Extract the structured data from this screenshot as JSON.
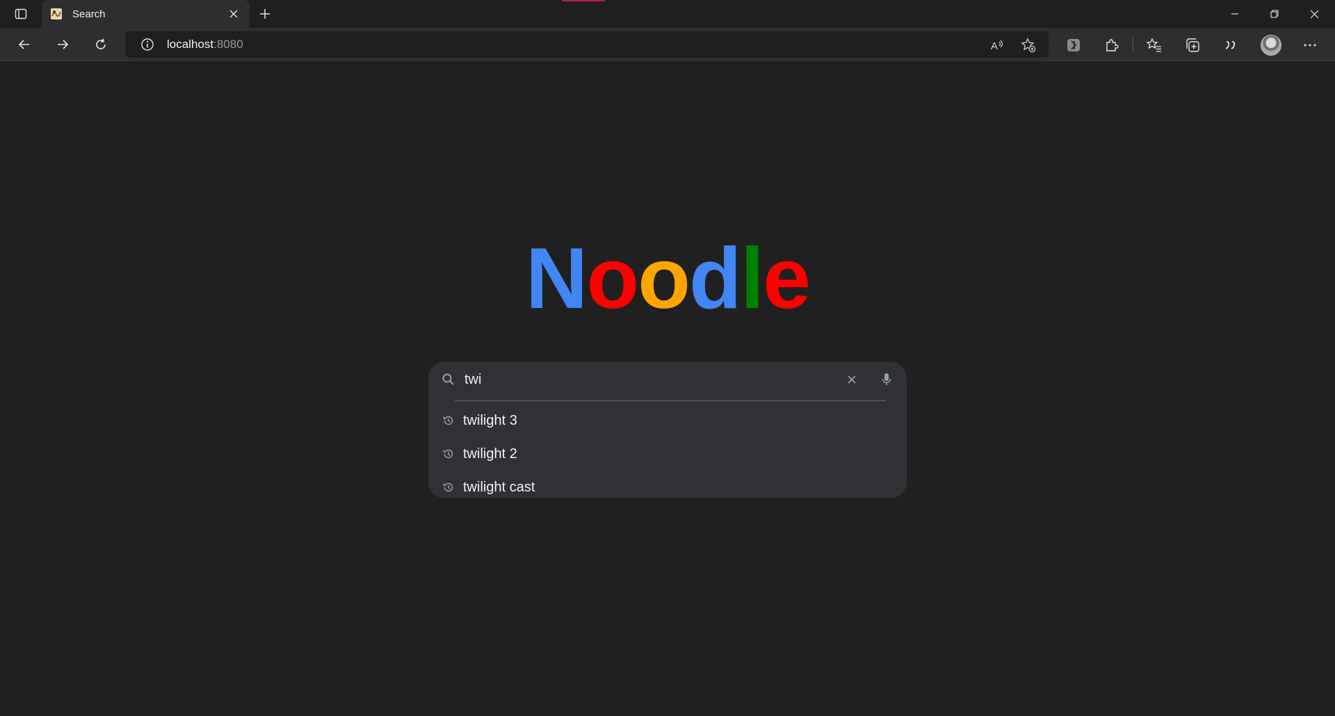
{
  "browser": {
    "tab": {
      "title": "Search",
      "favicon": "noodle-favicon"
    },
    "address": {
      "host": "localhost",
      "port": ":8080"
    },
    "icons": {
      "tab_actions": "tab-actions-icon",
      "new_tab": "plus-icon",
      "back": "back-arrow-icon",
      "forward": "forward-arrow-icon",
      "refresh": "refresh-icon",
      "site_info": "info-icon",
      "read_aloud": "read-aloud-icon",
      "add_favorite": "add-favorite-icon",
      "extension_1": "extension-badge-icon",
      "extensions": "puzzle-icon",
      "favorites": "favorites-list-icon",
      "collections": "collections-icon",
      "quote": "quote-icon",
      "profile": "avatar",
      "more": "more-dots-icon"
    }
  },
  "page": {
    "logo": {
      "letters": [
        {
          "char": "N",
          "color": "#4285f4"
        },
        {
          "char": "o",
          "color": "#ff0000"
        },
        {
          "char": "o",
          "color": "#ffa500"
        },
        {
          "char": "d",
          "color": "#4285f4"
        },
        {
          "char": "l",
          "color": "#008000"
        },
        {
          "char": "e",
          "color": "#ff0000"
        }
      ]
    },
    "search": {
      "value": "twi",
      "suggestions": [
        {
          "text": "twilight 3",
          "icon": "history-icon"
        },
        {
          "text": "twilight 2",
          "icon": "history-icon"
        },
        {
          "text": "twilight cast",
          "icon": "history-icon"
        }
      ]
    }
  },
  "colors": {
    "background": "#202020",
    "search_box": "#303134",
    "accent_media": "#c2185b"
  }
}
